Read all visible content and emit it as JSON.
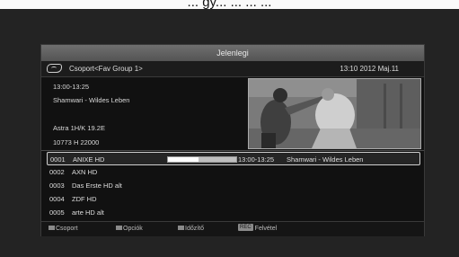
{
  "top_caption": "... gy... ... ... ...",
  "window": {
    "title": "Jelenlegi"
  },
  "info_bar": {
    "group": "Csoport<Fav Group 1>",
    "datetime": "13:10 2012 Maj.11"
  },
  "program": {
    "time": "13:00-13:25",
    "title": "Shamwari - Wildes Leben",
    "satellite": "Astra 1H/K 19.2E",
    "transponder": "10773 H 22000"
  },
  "channels": [
    {
      "num": "0001",
      "name": "ANIXE HD",
      "selected": true,
      "progress": 0.45,
      "time": "13:00-13:25",
      "program": "Shamwari - Wildes Leben"
    },
    {
      "num": "0002",
      "name": "AXN HD"
    },
    {
      "num": "0003",
      "name": "Das Erste HD alt"
    },
    {
      "num": "0004",
      "name": "ZDF HD"
    },
    {
      "num": "0005",
      "name": "arte HD alt"
    }
  ],
  "footer": {
    "csoport": "Csoport",
    "opciok": "Opciók",
    "idozito": "Időzítő",
    "rec_tag": "REC",
    "felvetel": "Felvétel"
  }
}
